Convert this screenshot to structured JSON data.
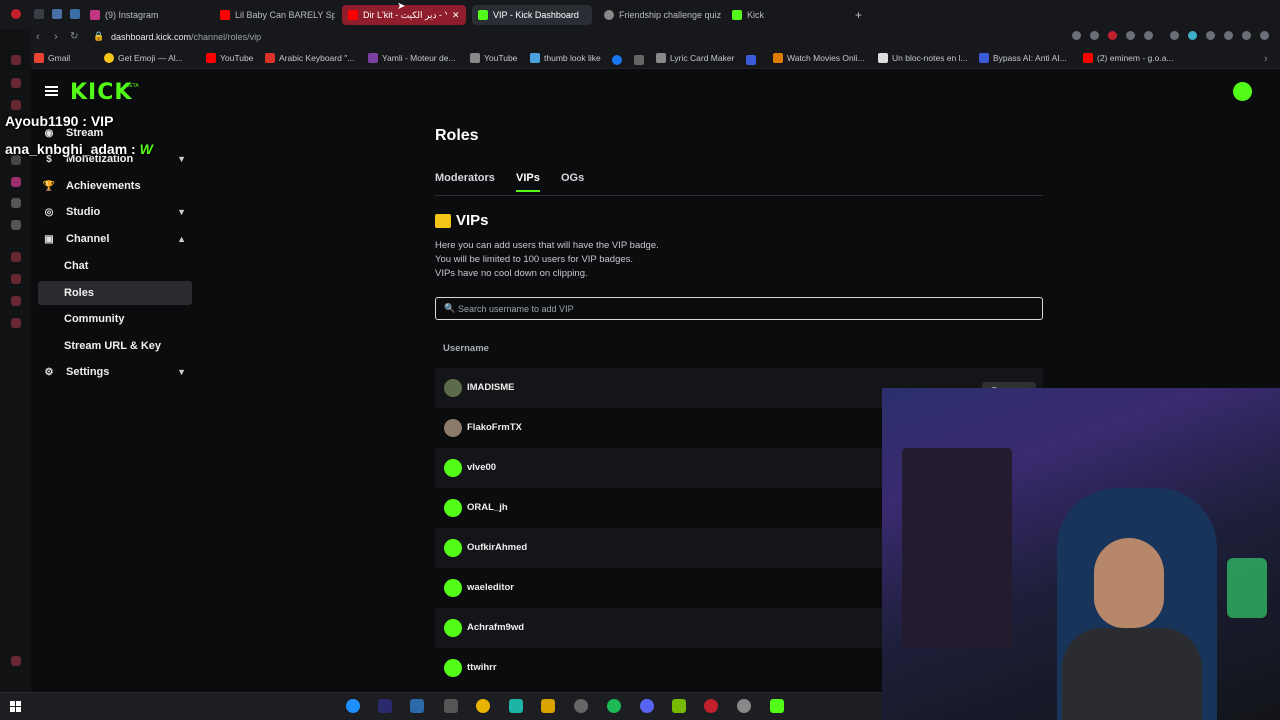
{
  "browser": {
    "tabs": [
      {
        "label": "(9) Instagram",
        "color": "#c13584"
      },
      {
        "label": "Lil Baby Can BARELY Spe",
        "color": "#ff0000"
      },
      {
        "label": "Dir L'kit - دير الكيت - Y",
        "color": "#ff0000"
      },
      {
        "label": "VIP - Kick Dashboard",
        "color": "#53fc18"
      },
      {
        "label": "Friendship challenge quiz",
        "color": "#888888"
      },
      {
        "label": "Kick",
        "color": "#53fc18"
      }
    ],
    "new_tab": "+",
    "url_host": "dashboard.kick.com",
    "url_path": "/channel/roles/vip",
    "bookmarks": [
      {
        "label": "Gmail",
        "color": "#ea4335"
      },
      {
        "label": "Get Emoji — Al...",
        "color": "#f5c518"
      },
      {
        "label": "YouTube",
        "color": "#ff0000"
      },
      {
        "label": "Arabic Keyboard \"...",
        "color": "#d9342b"
      },
      {
        "label": "Yamli - Moteur de...",
        "color": "#7b3fa0"
      },
      {
        "label": "YouTube",
        "color": "#888888"
      },
      {
        "label": "thumb look like",
        "color": "#4aa3df"
      },
      {
        "label": "Lyric Card Maker",
        "color": "#888888"
      },
      {
        "label": "Watch Movies Onli...",
        "color": "#e07b00"
      },
      {
        "label": "Un bloc-notes en l...",
        "color": "#dddddd"
      },
      {
        "label": "Bypass AI: Anti AI...",
        "color": "#3b5bdb"
      },
      {
        "label": "(2) eminem - g.o.a...",
        "color": "#ff0000"
      }
    ]
  },
  "kick": {
    "logo": "KICK",
    "beta": "BETA",
    "brand_color": "#53fc18"
  },
  "sidebar": {
    "items": [
      {
        "label": "Stream",
        "icon": "stream-icon"
      },
      {
        "label": "Monetization",
        "icon": "dollar-icon"
      },
      {
        "label": "Achievements",
        "icon": "trophy-icon"
      },
      {
        "label": "Studio",
        "icon": "studio-icon"
      },
      {
        "label": "Channel",
        "icon": "channel-icon"
      },
      {
        "label": "Settings",
        "icon": "gear-icon"
      }
    ],
    "channel_sub": [
      "Chat",
      "Roles",
      "Community",
      "Stream URL & Key"
    ]
  },
  "overlay": {
    "line1": "Ayoub1190 : VIP",
    "line2_user": "ana_knbghi_adam :",
    "line2_msg": "W"
  },
  "main": {
    "title": "Roles",
    "tabs": [
      "Moderators",
      "VIPs",
      "OGs"
    ],
    "section_title": "VIPs",
    "description": [
      "Here you can add users that will have the VIP badge.",
      "You will be limited to 100 users for VIP badges.",
      "VIPs have no cool down on clipping."
    ],
    "search_placeholder": "Search username to add VIP",
    "column_header": "Username",
    "remove_label": "Remove",
    "users": [
      "IMADISME",
      "FlakoFrmTX",
      "vIve00",
      "ORAL_jh",
      "OufkirAhmed",
      "waeleditor",
      "Achrafm9wd",
      "ttwihrr"
    ]
  }
}
